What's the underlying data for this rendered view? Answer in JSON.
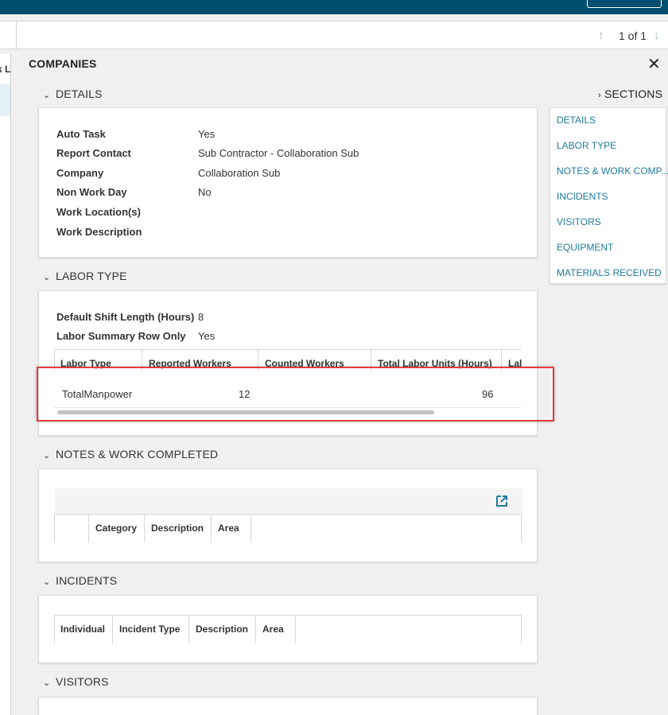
{
  "pager": {
    "count": "1 of 1"
  },
  "left_strip": {
    "text": "k L"
  },
  "panel": {
    "title": "COMPANIES"
  },
  "sections_toggle": "SECTIONS",
  "sections": [
    "DETAILS",
    "LABOR TYPE",
    "NOTES & WORK COMP...",
    "INCIDENTS",
    "VISITORS",
    "EQUIPMENT",
    "MATERIALS RECEIVED"
  ],
  "details": {
    "heading": "DETAILS",
    "rows": [
      {
        "label": "Auto Task",
        "value": "Yes"
      },
      {
        "label": "Report Contact",
        "value": "Sub Contractor - Collaboration Sub"
      },
      {
        "label": "Company",
        "value": "Collaboration Sub"
      },
      {
        "label": "Non Work Day",
        "value": "No"
      },
      {
        "label": "Work Location(s)",
        "value": ""
      },
      {
        "label": "Work Description",
        "value": ""
      }
    ]
  },
  "labor_type": {
    "heading": "LABOR TYPE",
    "rows": [
      {
        "label": "Default Shift Length (Hours)",
        "value": "8"
      },
      {
        "label": "Labor Summary Row Only",
        "value": "Yes"
      }
    ],
    "columns": [
      "Labor Type",
      "Reported Workers",
      "Counted Workers",
      "Total Labor Units (Hours)",
      "Lal"
    ],
    "data_row": {
      "labor_type": "TotalManpower",
      "reported_workers": "12",
      "counted_workers": "",
      "total_labor_units": "96"
    }
  },
  "notes": {
    "heading": "NOTES & WORK COMPLETED",
    "columns": [
      "Category",
      "Description",
      "Area"
    ]
  },
  "incidents": {
    "heading": "INCIDENTS",
    "columns": [
      "Individual",
      "Incident Type",
      "Description",
      "Area"
    ]
  },
  "visitors": {
    "heading": "VISITORS"
  },
  "colors": {
    "accent": "#1f7a9c",
    "topbar": "#004f6e",
    "highlight": "#e23d3d"
  }
}
